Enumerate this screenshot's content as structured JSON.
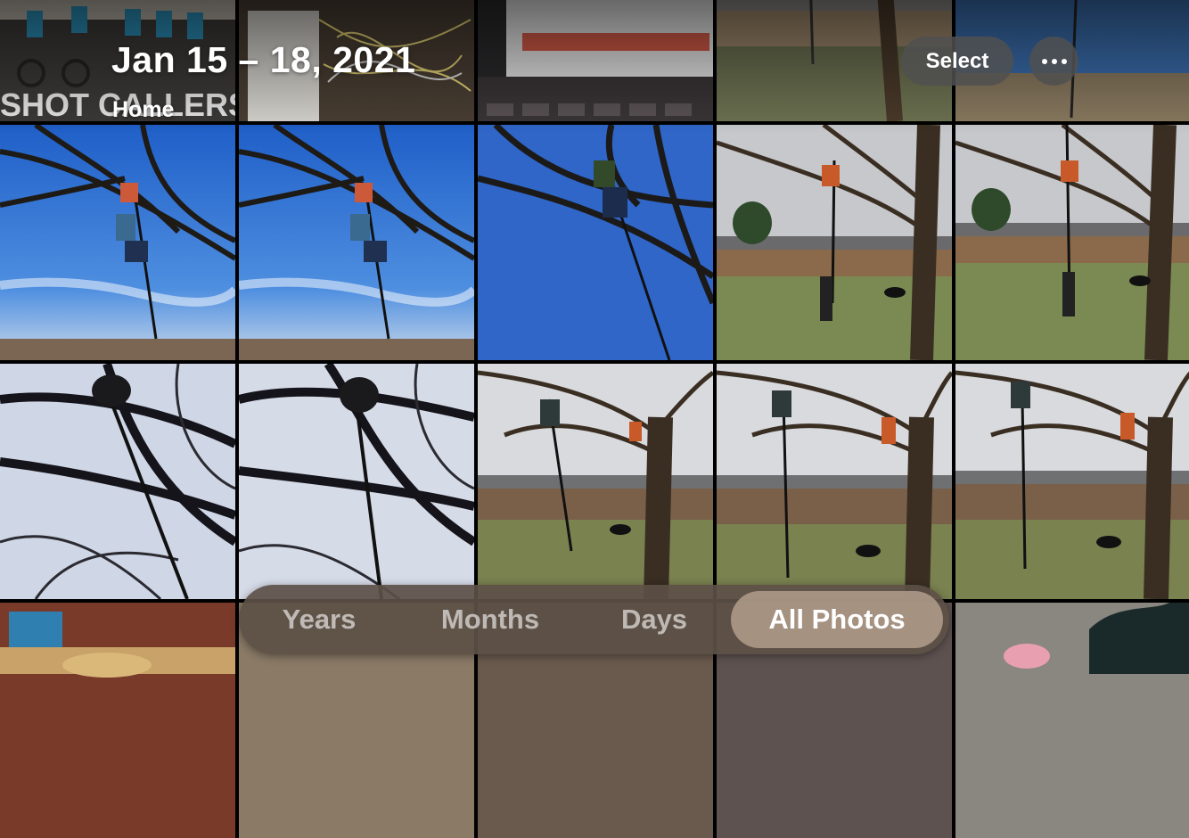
{
  "header": {
    "date_range": "Jan 15 – 18, 2021",
    "location": "Home"
  },
  "toolbar": {
    "select_label": "Select",
    "more_icon": "ellipsis-icon"
  },
  "thumbnail_labels": {
    "shot_callers_banner": "SHOT CALLERS"
  },
  "view_switcher": {
    "tabs": [
      {
        "label": "Years",
        "active": false
      },
      {
        "label": "Months",
        "active": false
      },
      {
        "label": "Days",
        "active": false
      },
      {
        "label": "All Photos",
        "active": true
      }
    ]
  }
}
